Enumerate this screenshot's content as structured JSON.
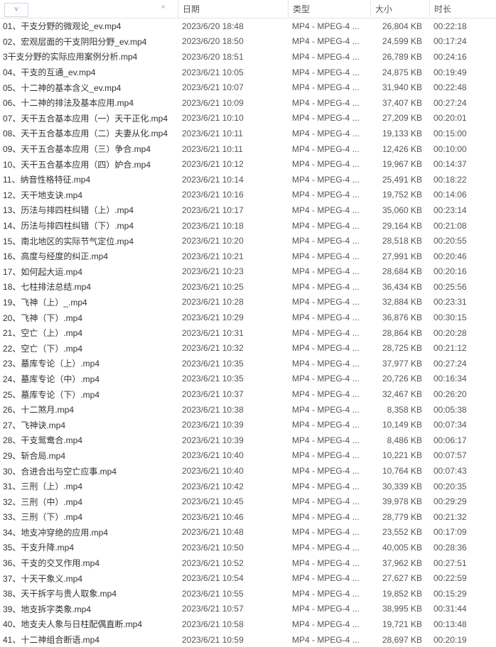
{
  "header": {
    "name_caret": "^",
    "date": "日期",
    "type": "类型",
    "size": "大小",
    "duration": "时长"
  },
  "type_label": "MP4 - MPEG-4 ...",
  "files": [
    {
      "name": "01、干支分野的微观论_ev.mp4",
      "date": "2023/6/20 18:48",
      "size": "26,804 KB",
      "dur": "00:22:18"
    },
    {
      "name": "02、宏观层面的干支阴阳分野_ev.mp4",
      "date": "2023/6/20 18:50",
      "size": "24,599 KB",
      "dur": "00:17:24"
    },
    {
      "name": "3干支分野的实际应用案例分析.mp4",
      "date": "2023/6/20 18:51",
      "size": "26,789 KB",
      "dur": "00:24:16"
    },
    {
      "name": "04、干支的互通_ev.mp4",
      "date": "2023/6/21 10:05",
      "size": "24,875 KB",
      "dur": "00:19:49"
    },
    {
      "name": "05、十二神的基本含义_ev.mp4",
      "date": "2023/6/21 10:07",
      "size": "31,940 KB",
      "dur": "00:22:48"
    },
    {
      "name": "06、十二神的排法及基本应用.mp4",
      "date": "2023/6/21 10:09",
      "size": "37,407 KB",
      "dur": "00:27:24"
    },
    {
      "name": "07、天干五合基本应用（一）天干正化.mp4",
      "date": "2023/6/21 10:10",
      "size": "27,209 KB",
      "dur": "00:20:01"
    },
    {
      "name": "08、天干五合基本应用（二）夫妻从化.mp4",
      "date": "2023/6/21 10:11",
      "size": "19,133 KB",
      "dur": "00:15:00"
    },
    {
      "name": "09、天干五合基本应用（三）争合.mp4",
      "date": "2023/6/21 10:11",
      "size": "12,426 KB",
      "dur": "00:10:00"
    },
    {
      "name": "10、天干五合基本应用（四）妒合.mp4",
      "date": "2023/6/21 10:12",
      "size": "19,967 KB",
      "dur": "00:14:37"
    },
    {
      "name": "11、纳音性格特征.mp4",
      "date": "2023/6/21 10:14",
      "size": "25,491 KB",
      "dur": "00:18:22"
    },
    {
      "name": "12、天干地支诀.mp4",
      "date": "2023/6/21 10:16",
      "size": "19,752 KB",
      "dur": "00:14:06"
    },
    {
      "name": "13、历法与排四柱纠错（上）.mp4",
      "date": "2023/6/21 10:17",
      "size": "35,060 KB",
      "dur": "00:23:14"
    },
    {
      "name": "14、历法与排四柱纠错（下）.mp4",
      "date": "2023/6/21 10:18",
      "size": "29,164 KB",
      "dur": "00:21:08"
    },
    {
      "name": "15、南北地区的实际节气定位.mp4",
      "date": "2023/6/21 10:20",
      "size": "28,518 KB",
      "dur": "00:20:55"
    },
    {
      "name": "16、高度与经度的纠正.mp4",
      "date": "2023/6/21 10:21",
      "size": "27,991 KB",
      "dur": "00:20:46"
    },
    {
      "name": "17、如何起大运.mp4",
      "date": "2023/6/21 10:23",
      "size": "28,684 KB",
      "dur": "00:20:16"
    },
    {
      "name": "18、七柱排法总结.mp4",
      "date": "2023/6/21 10:25",
      "size": "36,434 KB",
      "dur": "00:25:56"
    },
    {
      "name": "19、飞神（上）_.mp4",
      "date": "2023/6/21 10:28",
      "size": "32,884 KB",
      "dur": "00:23:31"
    },
    {
      "name": "20、飞神（下）.mp4",
      "date": "2023/6/21 10:29",
      "size": "36,876 KB",
      "dur": "00:30:15"
    },
    {
      "name": "21、空亡（上）.mp4",
      "date": "2023/6/21 10:31",
      "size": "28,864 KB",
      "dur": "00:20:28"
    },
    {
      "name": "22、空亡（下）.mp4",
      "date": "2023/6/21 10:32",
      "size": "28,725 KB",
      "dur": "00:21:12"
    },
    {
      "name": "23、墓库专论（上）.mp4",
      "date": "2023/6/21 10:35",
      "size": "37,977 KB",
      "dur": "00:27:24"
    },
    {
      "name": "24、墓库专论（中）.mp4",
      "date": "2023/6/21 10:35",
      "size": "20,726 KB",
      "dur": "00:16:34"
    },
    {
      "name": "25、墓库专论（下）.mp4",
      "date": "2023/6/21 10:37",
      "size": "32,467 KB",
      "dur": "00:26:20"
    },
    {
      "name": "26、十二煞月.mp4",
      "date": "2023/6/21 10:38",
      "size": "8,358 KB",
      "dur": "00:05:38"
    },
    {
      "name": "27、飞神诀.mp4",
      "date": "2023/6/21 10:39",
      "size": "10,149 KB",
      "dur": "00:07:34"
    },
    {
      "name": "28、干支鸳鸯合.mp4",
      "date": "2023/6/21 10:39",
      "size": "8,486 KB",
      "dur": "00:06:17"
    },
    {
      "name": "29、斩合局.mp4",
      "date": "2023/6/21 10:40",
      "size": "10,221 KB",
      "dur": "00:07:57"
    },
    {
      "name": "30、合进合出与空亡应事.mp4",
      "date": "2023/6/21 10:40",
      "size": "10,764 KB",
      "dur": "00:07:43"
    },
    {
      "name": "31、三刑（上）.mp4",
      "date": "2023/6/21 10:42",
      "size": "30,339 KB",
      "dur": "00:20:35"
    },
    {
      "name": "32、三刑（中）.mp4",
      "date": "2023/6/21 10:45",
      "size": "39,978 KB",
      "dur": "00:29:29"
    },
    {
      "name": "33、三刑（下）.mp4",
      "date": "2023/6/21 10:46",
      "size": "28,779 KB",
      "dur": "00:21:32"
    },
    {
      "name": "34、地支冲穿绝的应用.mp4",
      "date": "2023/6/21 10:48",
      "size": "23,552 KB",
      "dur": "00:17:09"
    },
    {
      "name": "35、干支升降.mp4",
      "date": "2023/6/21 10:50",
      "size": "40,005 KB",
      "dur": "00:28:36"
    },
    {
      "name": "36、干支的交叉作用.mp4",
      "date": "2023/6/21 10:52",
      "size": "37,962 KB",
      "dur": "00:27:51"
    },
    {
      "name": "37、十天干象义.mp4",
      "date": "2023/6/21 10:54",
      "size": "27,627 KB",
      "dur": "00:22:59"
    },
    {
      "name": "38、天干拆字与贵人取象.mp4",
      "date": "2023/6/21 10:55",
      "size": "19,852 KB",
      "dur": "00:15:29"
    },
    {
      "name": "39、地支拆字类象.mp4",
      "date": "2023/6/21 10:57",
      "size": "38,995 KB",
      "dur": "00:31:44"
    },
    {
      "name": "40、地支夫人象与日柱配偶直断.mp4",
      "date": "2023/6/21 10:58",
      "size": "19,721 KB",
      "dur": "00:13:48"
    },
    {
      "name": "41、十二神组合断语.mp4",
      "date": "2023/6/21 10:59",
      "size": "28,697 KB",
      "dur": "00:20:19"
    }
  ]
}
